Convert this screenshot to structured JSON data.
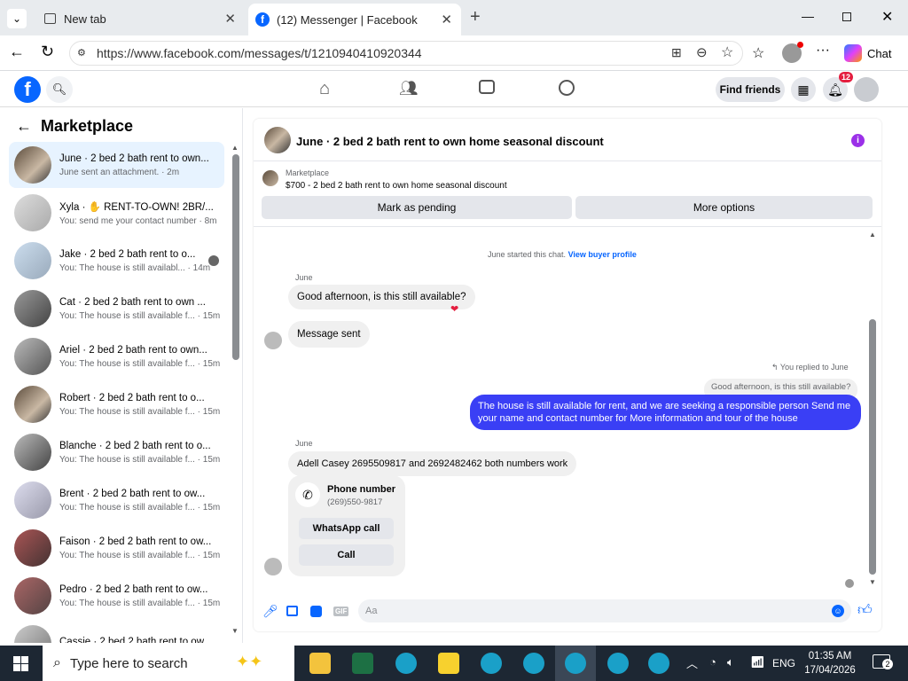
{
  "browser": {
    "tabs": [
      {
        "label": "New tab"
      },
      {
        "label": "(12) Messenger | Facebook"
      }
    ],
    "url": "https://www.facebook.com/messages/t/1210940410920344",
    "copilot_label": "Chat"
  },
  "fb_header": {
    "find_friends": "Find friends",
    "notification_count": "12"
  },
  "sidebar": {
    "title": "Marketplace",
    "items": [
      {
        "title": "June · 2 bed 2 bath rent to own...",
        "preview": "June sent an attachment. · 2m"
      },
      {
        "title": "Xyla · ✋ RENT-TO-OWN! 2BR/...",
        "preview": "You: send me your contact number · 8m"
      },
      {
        "title": "Jake · 2 bed 2 bath rent to o...",
        "preview": "You: The house is still availabl... · 14m"
      },
      {
        "title": "Cat · 2 bed 2 bath rent to own ...",
        "preview": "You: The house is still available f... · 15m"
      },
      {
        "title": "Ariel · 2 bed 2 bath rent to own...",
        "preview": "You: The house is still available f... · 15m"
      },
      {
        "title": "Robert · 2 bed 2 bath rent to o...",
        "preview": "You: The house is still available f... · 15m"
      },
      {
        "title": "Blanche · 2 bed 2 bath rent to o...",
        "preview": "You: The house is still available f... · 15m"
      },
      {
        "title": "Brent · 2 bed 2 bath rent to ow...",
        "preview": "You: The house is still available f... · 15m"
      },
      {
        "title": "Faison · 2 bed 2 bath rent to ow...",
        "preview": "You: The house is still available f... · 15m"
      },
      {
        "title": "Pedro · 2 bed 2 bath rent to ow...",
        "preview": "You: The house is still available f... · 15m"
      },
      {
        "title": "Cassie · 2 bed 2 bath rent to ow...",
        "preview": ""
      }
    ]
  },
  "chat": {
    "title": "June · 2 bed 2 bath rent to own home seasonal discount",
    "listing_label": "Marketplace",
    "listing_text": "$700 - 2 bed 2 bath rent to own home seasonal discount",
    "mark_pending": "Mark as pending",
    "more_options": "More options",
    "started_text": "June started this chat.",
    "view_profile": "View buyer profile",
    "sender_name": "June",
    "msg1": "Good afternoon, is this still available?",
    "msg_sent": "Message sent",
    "replied_to": "You replied to June",
    "quoted": "Good afternoon, is this still available?",
    "my_reply": "The  house is still available for rent, and we are seeking a responsible person  Send me your name and contact number for More information and tour of the house",
    "msg2": "Adell Casey 2695509817 and 2692482462 both numbers work",
    "phone_label": "Phone number",
    "phone_value": "(269)550-9817",
    "whatsapp_call": "WhatsApp call",
    "call": "Call",
    "composer_placeholder": "Aa"
  },
  "taskbar": {
    "search_placeholder": "Type here to search",
    "lang": "ENG",
    "time": "01:35 AM",
    "date": "17/04/2026",
    "notif_count": "2"
  },
  "colors": {
    "fb_blue": "#0866ff",
    "my_bubble": "#3a3ff5",
    "purple_info": "#9b30e8"
  }
}
